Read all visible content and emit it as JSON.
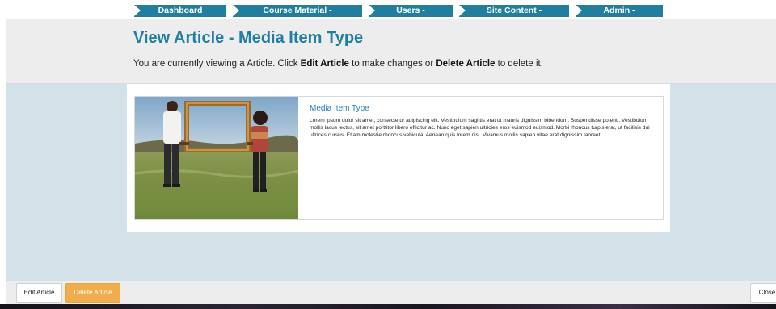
{
  "nav": {
    "items": [
      {
        "label": "Dashboard"
      },
      {
        "label": "Course Material -"
      },
      {
        "label": "Users -"
      },
      {
        "label": "Site Content -"
      },
      {
        "label": "Admin -"
      }
    ]
  },
  "header": {
    "title": "View Article - Media Item Type",
    "intro": {
      "prefix": "You are currently viewing a Article. Click ",
      "edit_bold": "Edit Article",
      "middle": " to make changes or ",
      "delete_bold": "Delete Article",
      "suffix": " to delete it."
    }
  },
  "article": {
    "title": "Media Item Type",
    "body": "Lorem ipsum dolor sit amet, consectetur adipiscing elit. Vestibulum sagittis erat ut mauris dignissim bibendum. Suspendisse potenti. Vestibulum mollis lacus lectus, sit amet porttitor libero efficitur ac. Nunc eget sapien ultricies eros euismod euismod. Morbi rhoncus turpis erat, ut facilisis dui ultrices cursus. Etiam molestie rhoncus vehicula. Aenean quis lorem nisi. Vivamus mollis sapien vitae erat dignissim laoreet.",
    "image_icon": "photo-icon"
  },
  "footer": {
    "edit_label": "Edit Article",
    "delete_label": "Delete Article",
    "close_label": "Close"
  },
  "colors": {
    "accent": "#217e9e",
    "title": "#217ea3",
    "delete": "#f0ad4e",
    "main_bg": "#d3e1e8"
  }
}
